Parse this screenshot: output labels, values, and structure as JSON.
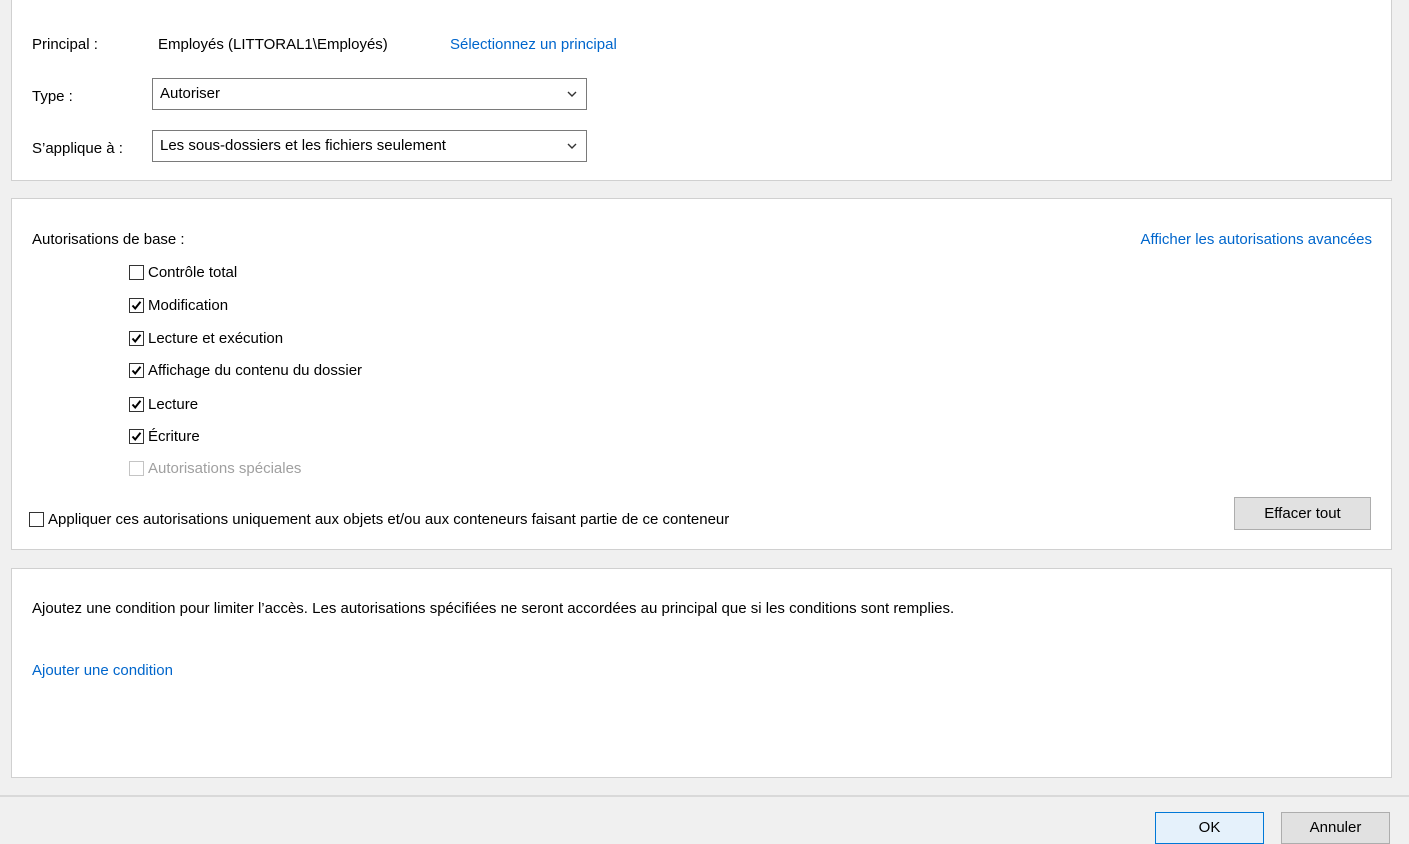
{
  "principal_section": {
    "principal_label": "Principal :",
    "principal_value": "Employés (LITTORAL1\\Employés)",
    "select_principal_link": "Sélectionnez un principal",
    "type_label": "Type :",
    "type_value": "Autoriser",
    "applies_to_label": "S’applique à :",
    "applies_to_value": "Les sous-dossiers et les fichiers seulement"
  },
  "permissions_section": {
    "title": "Autorisations de base :",
    "advanced_link": "Afficher les autorisations avancées",
    "items": [
      {
        "label": "Contrôle total",
        "checked": false,
        "enabled": true
      },
      {
        "label": "Modification",
        "checked": true,
        "enabled": true
      },
      {
        "label": "Lecture et exécution",
        "checked": true,
        "enabled": true
      },
      {
        "label": "Affichage du contenu du dossier",
        "checked": true,
        "enabled": true
      },
      {
        "label": "Lecture",
        "checked": true,
        "enabled": true
      },
      {
        "label": "Écriture",
        "checked": true,
        "enabled": true
      },
      {
        "label": "Autorisations spéciales",
        "checked": false,
        "enabled": false
      }
    ],
    "apply_only_label": "Appliquer ces autorisations uniquement aux objets et/ou aux conteneurs faisant partie de ce conteneur",
    "apply_only_checked": false,
    "clear_all_button": "Effacer tout"
  },
  "conditions_section": {
    "description": "Ajoutez une condition pour limiter l’accès. Les autorisations spécifiées ne seront accordées au principal que si les conditions sont remplies.",
    "add_condition_link": "Ajouter une condition"
  },
  "footer": {
    "ok_button": "OK",
    "cancel_button": "Annuler"
  },
  "colors": {
    "link": "#0066cc",
    "background": "#f0f0f0",
    "panel": "#ffffff",
    "button": "#e1e1e1",
    "primary_button_border": "#0078d7"
  },
  "icons": {
    "dropdown": "chevron-down-icon",
    "check": "checkmark-icon"
  }
}
